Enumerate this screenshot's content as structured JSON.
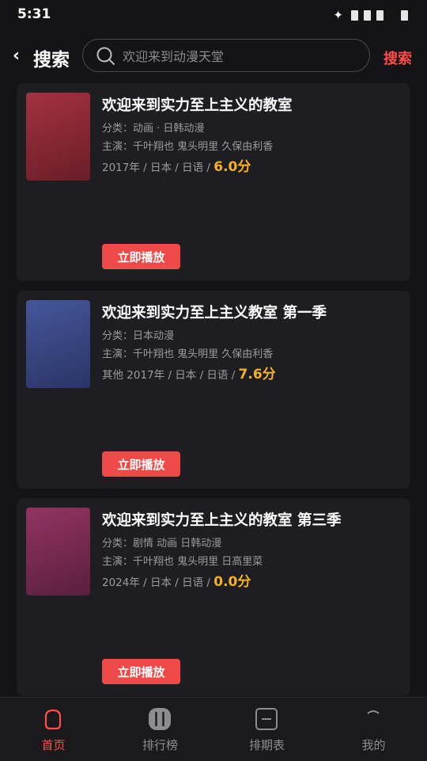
{
  "status_bar": {
    "time": "5:31",
    "star": "✦"
  },
  "header": {
    "back": "‹",
    "title": "搜索",
    "search_placeholder": "欢迎来到动漫天堂",
    "search_button": "搜索"
  },
  "results": [
    {
      "title": "欢迎来到实力至上主义的教室",
      "genre": "分类：动画 · 日韩动漫",
      "cast": "主演：千叶翔也 鬼头明里 久保由利香",
      "meta": "2017年 / 日本 / 日语 / ",
      "score": "6.0分",
      "play_label": "立即播放",
      "poster_color": "#8e2a36"
    },
    {
      "title": "欢迎来到实力至上主义教室 第一季",
      "genre": "分类：日本动漫",
      "cast": "主演：千叶翔也 鬼头明里 久保由利香",
      "meta": "其他 2017年 / 日本 / 日语 / ",
      "score": "7.6分",
      "play_label": "立即播放",
      "poster_color": "#3a4a86"
    },
    {
      "title": "欢迎来到实力至上主义的教室 第三季",
      "genre": "分类：剧情 动画 日韩动漫",
      "cast": "主演：千叶翔也 鬼头明里 日高里菜",
      "meta": "2024年 / 日本 / 日语 / ",
      "score": "0.0分",
      "play_label": "立即播放",
      "poster_color": "#7e2d52"
    }
  ],
  "bottom_nav": [
    {
      "label": "首页",
      "icon": "home-icon",
      "active": true
    },
    {
      "label": "排行榜",
      "icon": "ranking-icon",
      "active": false
    },
    {
      "label": "排期表",
      "icon": "schedule-icon",
      "active": false
    },
    {
      "label": "我的",
      "icon": "profile-icon",
      "active": false
    }
  ],
  "colors": {
    "accent": "#ff4d4a",
    "score": "#f7b125",
    "card_bg": "#1e1e22",
    "page_bg": "#141416"
  }
}
